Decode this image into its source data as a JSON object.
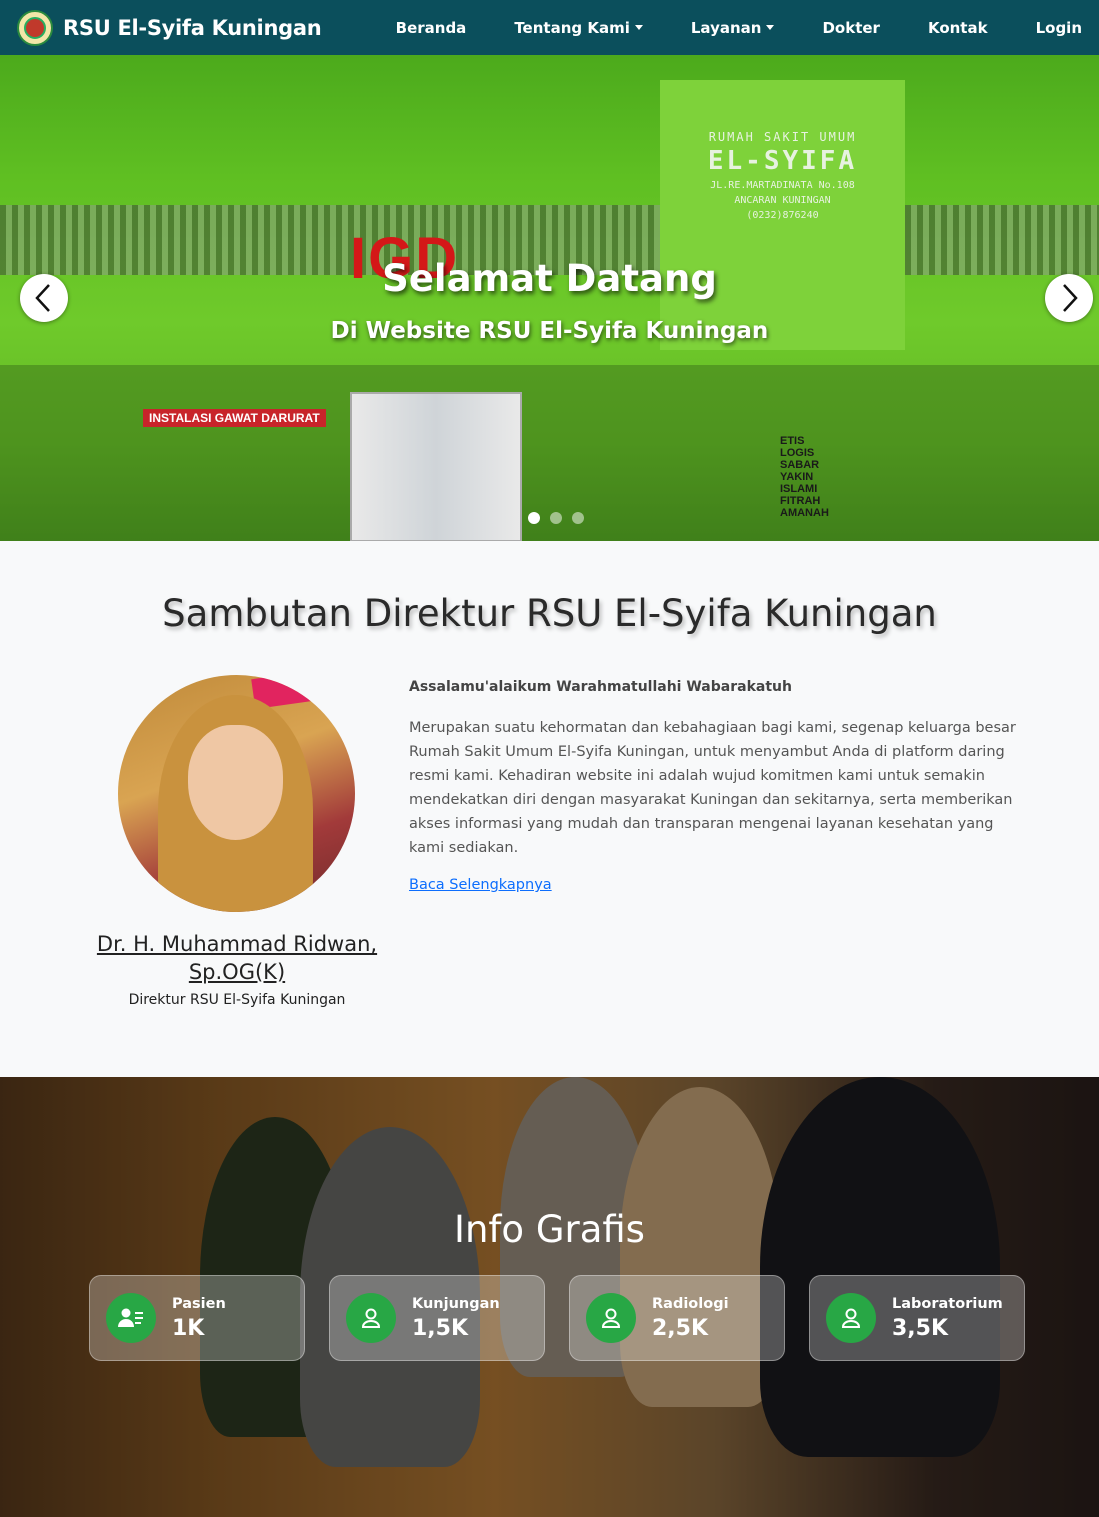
{
  "navbar": {
    "brand": "RSU El-Syifa Kuningan",
    "items": [
      {
        "label": "Beranda",
        "dropdown": false
      },
      {
        "label": "Tentang Kami",
        "dropdown": true
      },
      {
        "label": "Layanan",
        "dropdown": true
      },
      {
        "label": "Dokter",
        "dropdown": false
      },
      {
        "label": "Kontak",
        "dropdown": false
      },
      {
        "label": "Login",
        "dropdown": false
      }
    ]
  },
  "hero": {
    "title": "Selamat Datang",
    "subtitle": "Di Website RSU El-Syifa Kuningan",
    "slide_count": 3,
    "active_slide": 1,
    "photo_text": {
      "tower_line1": "RUMAH SAKIT UMUM",
      "tower_line2": "EL-SYIFA",
      "tower_line3": "JL.RE.MARTADINATA No.108",
      "tower_line4": "ANCARAN KUNINGAN",
      "tower_line5": "(0232)876240",
      "igd": "IGD",
      "sign": "INSTALASI GAWAT DARURAT",
      "values": [
        "ETIS",
        "LOGIS",
        "SABAR",
        "YAKIN",
        "ISLAMI",
        "FITRAH",
        "AMANAH"
      ]
    }
  },
  "director": {
    "section_title": "Sambutan Direktur RSU El-Syifa Kuningan",
    "name": "Dr. H. Muhammad Ridwan, Sp.OG(K)",
    "role": "Direktur RSU El-Syifa Kuningan",
    "greeting": "Assalamu'alaikum Warahmatullahi Wabarakatuh",
    "body": "Merupakan suatu kehormatan dan kebahagiaan bagi kami, segenap keluarga besar Rumah Sakit Umum El-Syifa Kuningan, untuk menyambut Anda di platform daring resmi kami. Kehadiran website ini adalah wujud komitmen kami untuk semakin mendekatkan diri dengan masyarakat Kuningan dan sekitarnya, serta memberikan akses informasi yang mudah dan transparan mengenai layanan kesehatan yang kami sediakan.",
    "read_more": "Baca Selengkapnya"
  },
  "info": {
    "title": "Info Grafis",
    "stats": [
      {
        "label": "Pasien",
        "value": "1K",
        "icon": "user-list-icon"
      },
      {
        "label": "Kunjungan",
        "value": "1,5K",
        "icon": "user-icon"
      },
      {
        "label": "Radiologi",
        "value": "2,5K",
        "icon": "user-icon"
      },
      {
        "label": "Laboratorium",
        "value": "3,5K",
        "icon": "user-icon"
      }
    ]
  },
  "colors": {
    "navbar_bg": "#0b4f5c",
    "accent_green": "#28a745",
    "link_blue": "#0d6efd"
  }
}
